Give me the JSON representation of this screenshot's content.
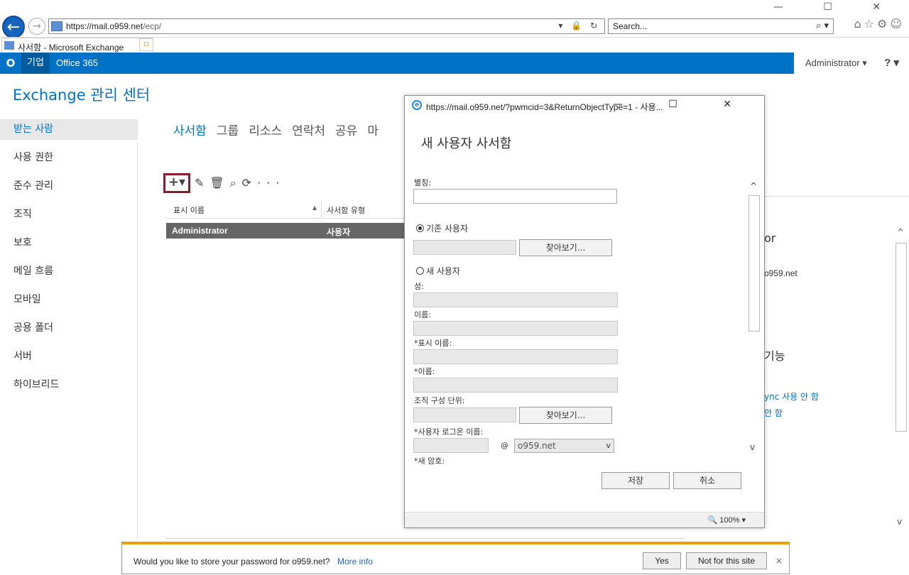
{
  "browser": {
    "url_host": "https://mail.o959.net",
    "url_path": "/ecp/",
    "address_tools": "▾ 🔒 ↻",
    "search_placeholder": "Search...",
    "search_tools": "⌕ ▾",
    "tab_title": "사서함 - Microsoft Exchange",
    "tab_close": "×",
    "new_tab": "▫",
    "window_controls": "— ☐ ✕",
    "right_icons": "⌂☆⚙☺"
  },
  "o365bar": {
    "logo": "O",
    "business": "기업",
    "office365": "Office 365",
    "admin": "Administrator ▾",
    "help": "? ▾"
  },
  "eac": {
    "title": "Exchange 관리 센터",
    "nav": [
      "받는 사람",
      "사용 권한",
      "준수 관리",
      "조직",
      "보호",
      "메일 흐름",
      "모바일",
      "공용 폴더",
      "서버",
      "하이브리드"
    ],
    "tabs": [
      "사서함",
      "그룹",
      "리소스",
      "연락처",
      "공유",
      "마"
    ],
    "toolbar": {
      "add": "+▾",
      "others": "✎🗑⌕⟳···"
    },
    "grid": {
      "col_display": "표시 이름",
      "sort": "▲",
      "col_type": "사서함 유형",
      "row_name": "Administrator",
      "row_type": "사용자"
    },
    "detail": {
      "frag1": "or",
      "frag2": "o959.net",
      "frag3": "기능",
      "frag4": "ync 사용 안 함",
      "frag5": "안 함"
    },
    "scroll": {
      "up": "^",
      "down": "v"
    }
  },
  "popup": {
    "title": "https://mail.o959.net/?pwmcid=3&ReturnObjectType=1 - 사용...",
    "title_icon": "e",
    "window_controls": "— ☐ ✕",
    "heading": "새 사용자 사서함",
    "alias_label": "별칭:",
    "existing_user": "기존 사용자",
    "browse1": "찾아보기...",
    "new_user": "새 사용자",
    "last_name": "성:",
    "first_name": "이름:",
    "display_name": "*표시 이름:",
    "name": "*이름:",
    "ou": "조직 구성 단위:",
    "browse2": "찾아보기...",
    "logon_name": "*사용자 로그온 이름:",
    "at": "@",
    "domain": "o959.net",
    "domain_caret": "v",
    "new_password": "*새 암호:",
    "save": "저장",
    "cancel": "취소",
    "zoom": "🔍 100%  ▾",
    "scroll_up": "^",
    "scroll_down": "v"
  },
  "password_bar": {
    "message": "Would you like to store your password for o959.net?",
    "more_info": "More info",
    "yes": "Yes",
    "not_for_site": "Not for this site",
    "close": "×"
  }
}
